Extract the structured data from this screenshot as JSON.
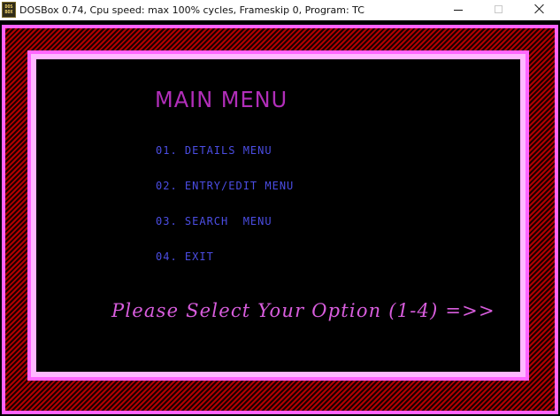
{
  "window": {
    "title": "DOSBox 0.74, Cpu speed: max 100% cycles, Frameskip  0, Program:      TC",
    "icon": "dosbox-icon",
    "icon_label": "DOS\nBOX",
    "controls": {
      "minimize_icon": "minimize-icon",
      "maximize_icon": "maximize-icon",
      "close_icon": "close-icon"
    },
    "colors": {
      "titlebar_background": "#ffffff",
      "titlebar_text": "#111111"
    }
  },
  "dos_program": {
    "screen_title": "MAIN MENU",
    "options": [
      "01. DETAILS MENU",
      "02. ENTRY/EDIT MENU",
      "03. SEARCH  MENU",
      "04. EXIT"
    ],
    "prompt": "Please Select Your Option (1-4) =>>",
    "colors": {
      "background": "#000000",
      "title": "#b12eb9",
      "menu_option": "#4b4de3",
      "prompt": "#d85ddd",
      "hatched_border_red": "#b20000",
      "hatched_border_dark": "#1a0000",
      "pink_frame": "#ff66ff",
      "lavender_frame": "#ffb8ff"
    }
  }
}
